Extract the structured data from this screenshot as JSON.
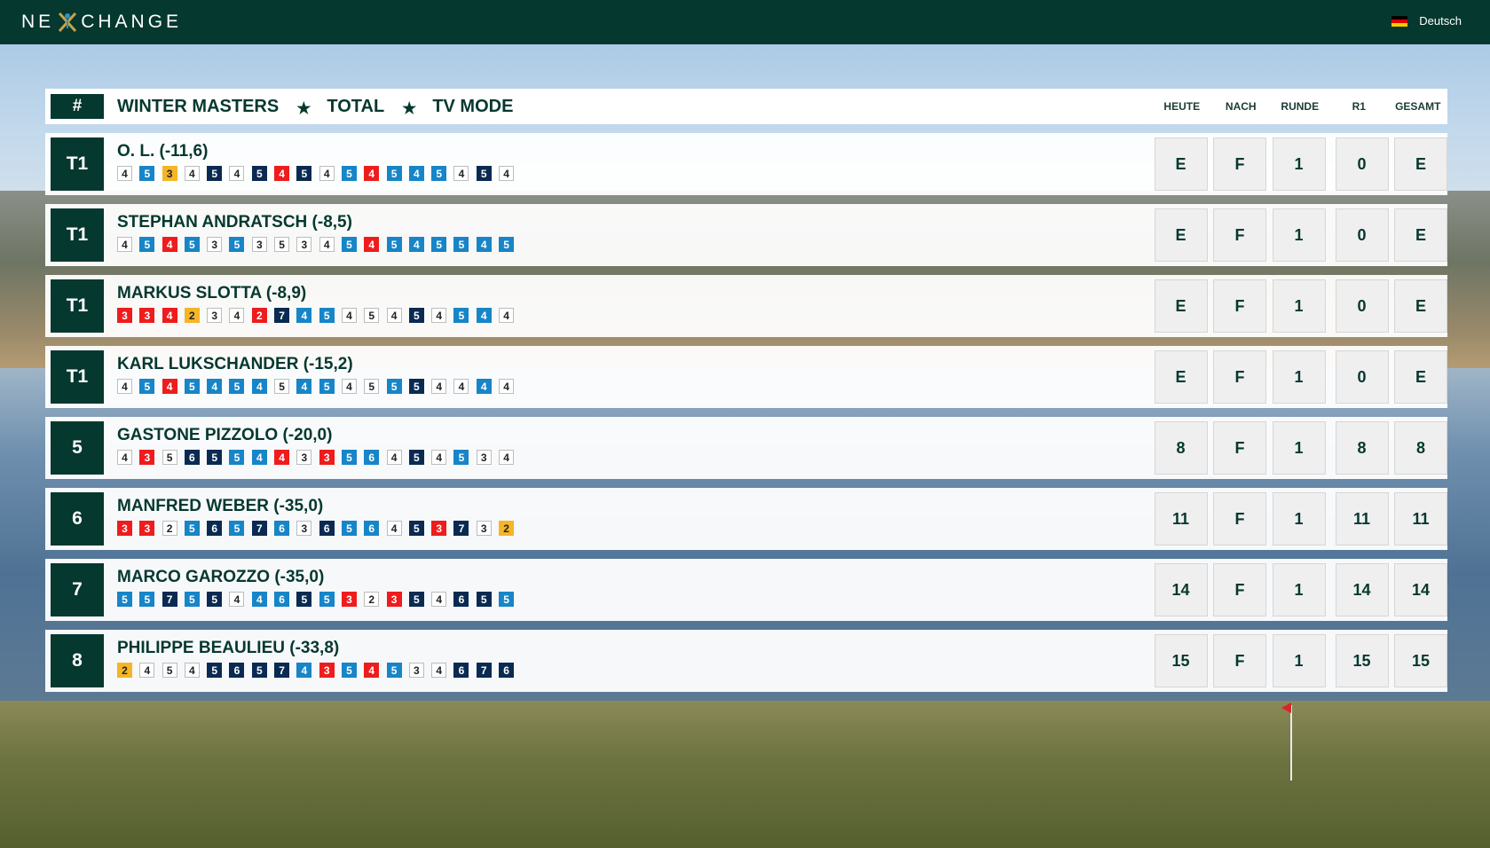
{
  "app": {
    "brand_left": "NE",
    "brand_right": "CHANGE",
    "language": "Deutsch"
  },
  "header": {
    "hash": "#",
    "tournament": "WINTER MASTERS",
    "view": "TOTAL",
    "mode": "TV MODE",
    "columns": [
      "HEUTE",
      "NACH",
      "RUNDE",
      "R1",
      "GESAMT"
    ]
  },
  "colors": {
    "primary": "#05382f",
    "par": "#ffffff",
    "bogey": "#1785c7",
    "double_bogey": "#0a2a52",
    "birdie": "#ee1c1c",
    "eagle": "#f5b527"
  },
  "players": [
    {
      "rank": "T1",
      "name": "O. L. (-11,6)",
      "scores": [
        "4",
        "5",
        "3",
        "4",
        "5",
        "4",
        "5",
        "4",
        "5",
        "4",
        "5",
        "4",
        "5",
        "4",
        "5",
        "4",
        "5",
        "4"
      ],
      "types": [
        "p",
        "b",
        "e",
        "p",
        "d",
        "p",
        "d",
        "r",
        "d",
        "p",
        "b",
        "r",
        "b",
        "b",
        "b",
        "p",
        "d",
        "p"
      ],
      "heute": "E",
      "nach": "F",
      "runde": "1",
      "r1": "0",
      "gesamt": "E"
    },
    {
      "rank": "T1",
      "name": "STEPHAN ANDRATSCH (-8,5)",
      "scores": [
        "4",
        "5",
        "4",
        "5",
        "3",
        "5",
        "3",
        "5",
        "3",
        "4",
        "5",
        "4",
        "5",
        "4",
        "5",
        "5",
        "4",
        "5"
      ],
      "types": [
        "p",
        "b",
        "r",
        "b",
        "p",
        "b",
        "p",
        "p",
        "p",
        "p",
        "b",
        "r",
        "b",
        "b",
        "b",
        "b",
        "b",
        "b"
      ],
      "heute": "E",
      "nach": "F",
      "runde": "1",
      "r1": "0",
      "gesamt": "E"
    },
    {
      "rank": "T1",
      "name": "MARKUS SLOTTA (-8,9)",
      "scores": [
        "3",
        "3",
        "4",
        "2",
        "3",
        "4",
        "2",
        "7",
        "4",
        "5",
        "4",
        "5",
        "4",
        "5",
        "4",
        "5",
        "4",
        "4"
      ],
      "types": [
        "r",
        "r",
        "r",
        "e",
        "p",
        "p",
        "r",
        "d",
        "b",
        "b",
        "p",
        "p",
        "p",
        "d",
        "p",
        "b",
        "b",
        "p"
      ],
      "heute": "E",
      "nach": "F",
      "runde": "1",
      "r1": "0",
      "gesamt": "E"
    },
    {
      "rank": "T1",
      "name": "KARL LUKSCHANDER (-15,2)",
      "scores": [
        "4",
        "5",
        "4",
        "5",
        "4",
        "5",
        "4",
        "5",
        "4",
        "5",
        "4",
        "5",
        "5",
        "5",
        "4",
        "4",
        "4",
        "4"
      ],
      "types": [
        "p",
        "b",
        "r",
        "b",
        "b",
        "b",
        "b",
        "p",
        "b",
        "b",
        "p",
        "p",
        "b",
        "d",
        "p",
        "p",
        "b",
        "p"
      ],
      "heute": "E",
      "nach": "F",
      "runde": "1",
      "r1": "0",
      "gesamt": "E"
    },
    {
      "rank": "5",
      "name": "GASTONE PIZZOLO (-20,0)",
      "scores": [
        "4",
        "3",
        "5",
        "6",
        "5",
        "5",
        "4",
        "4",
        "3",
        "3",
        "5",
        "6",
        "4",
        "5",
        "4",
        "5",
        "3",
        "4"
      ],
      "types": [
        "p",
        "r",
        "p",
        "d",
        "d",
        "b",
        "b",
        "r",
        "p",
        "r",
        "b",
        "b",
        "p",
        "d",
        "p",
        "b",
        "p",
        "p"
      ],
      "heute": "8",
      "nach": "F",
      "runde": "1",
      "r1": "8",
      "gesamt": "8"
    },
    {
      "rank": "6",
      "name": "MANFRED WEBER (-35,0)",
      "scores": [
        "3",
        "3",
        "2",
        "5",
        "6",
        "5",
        "7",
        "6",
        "3",
        "6",
        "5",
        "6",
        "4",
        "5",
        "3",
        "7",
        "3",
        "2"
      ],
      "types": [
        "r",
        "r",
        "p",
        "b",
        "d",
        "b",
        "d",
        "b",
        "p",
        "d",
        "b",
        "b",
        "p",
        "d",
        "r",
        "d",
        "p",
        "e"
      ],
      "heute": "11",
      "nach": "F",
      "runde": "1",
      "r1": "11",
      "gesamt": "11"
    },
    {
      "rank": "7",
      "name": "MARCO GAROZZO (-35,0)",
      "scores": [
        "5",
        "5",
        "7",
        "5",
        "5",
        "4",
        "4",
        "6",
        "5",
        "5",
        "3",
        "2",
        "3",
        "5",
        "4",
        "6",
        "5",
        "5"
      ],
      "types": [
        "b",
        "b",
        "d",
        "b",
        "d",
        "p",
        "b",
        "b",
        "d",
        "b",
        "r",
        "p",
        "r",
        "d",
        "p",
        "d",
        "d",
        "b"
      ],
      "heute": "14",
      "nach": "F",
      "runde": "1",
      "r1": "14",
      "gesamt": "14"
    },
    {
      "rank": "8",
      "name": "PHILIPPE BEAULIEU (-33,8)",
      "scores": [
        "2",
        "4",
        "5",
        "4",
        "5",
        "6",
        "5",
        "7",
        "4",
        "3",
        "5",
        "4",
        "5",
        "3",
        "4",
        "6",
        "7",
        "6"
      ],
      "types": [
        "e",
        "p",
        "p",
        "p",
        "d",
        "d",
        "d",
        "d",
        "b",
        "r",
        "b",
        "r",
        "b",
        "p",
        "p",
        "d",
        "d",
        "d"
      ],
      "heute": "15",
      "nach": "F",
      "runde": "1",
      "r1": "15",
      "gesamt": "15"
    }
  ]
}
